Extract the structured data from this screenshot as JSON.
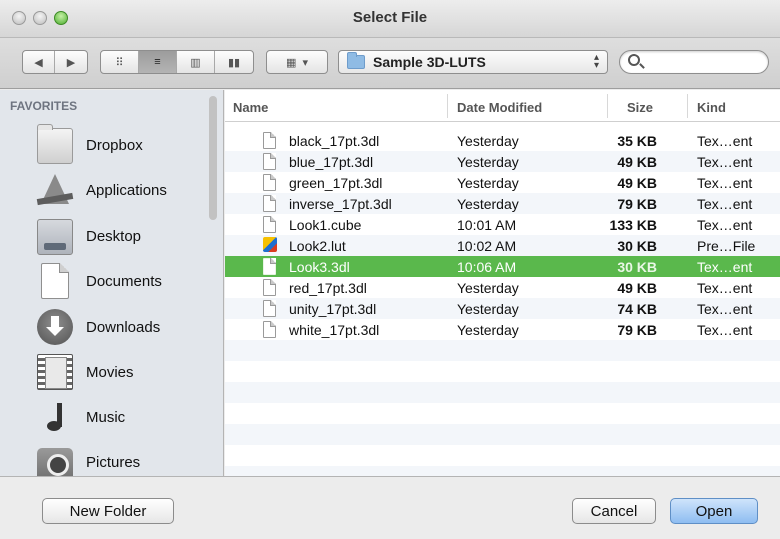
{
  "window": {
    "title": "Select File"
  },
  "toolbar": {
    "back_glyph": "◀",
    "forward_glyph": "▶",
    "view_glyphs": [
      "⠿",
      "≡",
      "▥",
      "▮▮"
    ],
    "arrange_glyph": "▦",
    "arrange_arrow": "▾",
    "path_label": "Sample 3D-LUTS",
    "path_arrows": "▴\n▾",
    "search_placeholder": ""
  },
  "sidebar": {
    "heading": "FAVORITES",
    "items": [
      {
        "label": "Dropbox",
        "icon": "folder-icon"
      },
      {
        "label": "Applications",
        "icon": "applications-icon"
      },
      {
        "label": "Desktop",
        "icon": "desktop-icon"
      },
      {
        "label": "Documents",
        "icon": "documents-icon"
      },
      {
        "label": "Downloads",
        "icon": "downloads-icon"
      },
      {
        "label": "Movies",
        "icon": "movies-icon"
      },
      {
        "label": "Music",
        "icon": "music-icon"
      },
      {
        "label": "Pictures",
        "icon": "pictures-icon"
      }
    ]
  },
  "list": {
    "columns": {
      "name": "Name",
      "date": "Date Modified",
      "size": "Size",
      "kind": "Kind"
    },
    "rows": [
      {
        "name": "black_17pt.3dl",
        "date": "Yesterday",
        "size": "35 KB",
        "kind": "Tex…ent",
        "icon": "file-icon"
      },
      {
        "name": "blue_17pt.3dl",
        "date": "Yesterday",
        "size": "49 KB",
        "kind": "Tex…ent",
        "icon": "file-icon"
      },
      {
        "name": "green_17pt.3dl",
        "date": "Yesterday",
        "size": "49 KB",
        "kind": "Tex…ent",
        "icon": "file-icon"
      },
      {
        "name": "inverse_17pt.3dl",
        "date": "Yesterday",
        "size": "79 KB",
        "kind": "Tex…ent",
        "icon": "file-icon"
      },
      {
        "name": "Look1.cube",
        "date": "10:01 AM",
        "size": "133 KB",
        "kind": "Tex…ent",
        "icon": "file-icon"
      },
      {
        "name": "Look2.lut",
        "date": "10:02 AM",
        "size": "30 KB",
        "kind": "Pre…File",
        "icon": "lut-icon"
      },
      {
        "name": "Look3.3dl",
        "date": "10:06 AM",
        "size": "30 KB",
        "kind": "Tex…ent",
        "icon": "file-icon",
        "selected": true
      },
      {
        "name": "red_17pt.3dl",
        "date": "Yesterday",
        "size": "49 KB",
        "kind": "Tex…ent",
        "icon": "file-icon"
      },
      {
        "name": "unity_17pt.3dl",
        "date": "Yesterday",
        "size": "74 KB",
        "kind": "Tex…ent",
        "icon": "file-icon"
      },
      {
        "name": "white_17pt.3dl",
        "date": "Yesterday",
        "size": "79 KB",
        "kind": "Tex…ent",
        "icon": "file-icon"
      }
    ]
  },
  "footer": {
    "new_folder": "New Folder",
    "cancel": "Cancel",
    "open": "Open"
  },
  "colors": {
    "selection": "#5ab84c",
    "sidebar_bg": "#e2e6eb",
    "default_button": "#8ebdf1"
  }
}
